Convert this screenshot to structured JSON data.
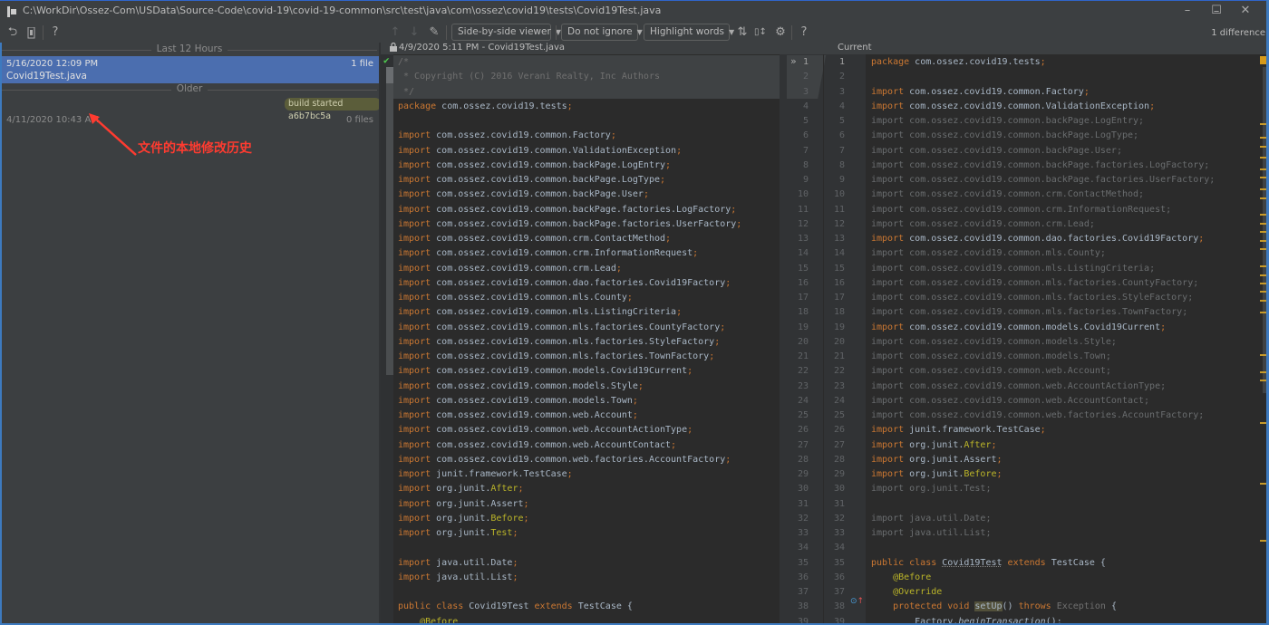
{
  "window": {
    "title": "C:\\WorkDir\\Ossez-Com\\USData\\Source-Code\\covid-19\\covid-19-common\\src\\test\\java\\com\\ossez\\covid19\\tests\\Covid19Test.java",
    "minimize": "–",
    "maximize": "☐",
    "close": "✕"
  },
  "toolbar": {
    "revert_icon": "⮌",
    "patch_icon": "▮",
    "help_icon": "?",
    "prev_diff_icon": "↑",
    "next_diff_icon": "↓",
    "edit_icon": "✎",
    "viewer_select": "Side-by-side viewer",
    "ignore_select": "Do not ignore",
    "highlight_select": "Highlight words",
    "collapse_icon": "⇅",
    "sync_scroll_icon": "▯↕",
    "settings_icon": "⚙",
    "help2_icon": "?",
    "dropdown_arrow": "▼",
    "diff_count": "1 difference"
  },
  "history": {
    "groups": [
      {
        "label": "Last 12 Hours"
      },
      {
        "label": "Older"
      }
    ],
    "revisions": [
      {
        "date": "5/16/2020 12:09 PM",
        "file": "Covid19Test.java",
        "count": "1 file",
        "selected": true
      },
      {
        "label": "build started a6b7bc5a",
        "date": "4/11/2020 10:43 AM",
        "count": "0 files",
        "selected": false
      }
    ],
    "annotation": "文件的本地修改历史"
  },
  "left_pane": {
    "header": "4/9/2020 5:11 PM - Covid19Test.java",
    "lock_icon": "🔒",
    "ok_icon": "✔",
    "lines": [
      [
        [
          "cm",
          "/*"
        ]
      ],
      [
        [
          "cm",
          " * Copyright (C) 2016 Verani Realty, Inc Authors"
        ]
      ],
      [
        [
          "cm",
          " */"
        ]
      ],
      [
        [
          "kw",
          "package "
        ],
        [
          "id",
          "com.ossez.covid19.tests"
        ],
        [
          "sc",
          ";"
        ]
      ],
      [],
      [
        [
          "kw",
          "import "
        ],
        [
          "id",
          "com.ossez.covid19.common.Factory"
        ],
        [
          "sc",
          ";"
        ]
      ],
      [
        [
          "kw",
          "import "
        ],
        [
          "id",
          "com.ossez.covid19.common.ValidationException"
        ],
        [
          "sc",
          ";"
        ]
      ],
      [
        [
          "kw",
          "import "
        ],
        [
          "id",
          "com.ossez.covid19.common.backPage.LogEntry"
        ],
        [
          "sc",
          ";"
        ]
      ],
      [
        [
          "kw",
          "import "
        ],
        [
          "id",
          "com.ossez.covid19.common.backPage.LogType"
        ],
        [
          "sc",
          ";"
        ]
      ],
      [
        [
          "kw",
          "import "
        ],
        [
          "id",
          "com.ossez.covid19.common.backPage.User"
        ],
        [
          "sc",
          ";"
        ]
      ],
      [
        [
          "kw",
          "import "
        ],
        [
          "id",
          "com.ossez.covid19.common.backPage.factories.LogFactory"
        ],
        [
          "sc",
          ";"
        ]
      ],
      [
        [
          "kw",
          "import "
        ],
        [
          "id",
          "com.ossez.covid19.common.backPage.factories.UserFactory"
        ],
        [
          "sc",
          ";"
        ]
      ],
      [
        [
          "kw",
          "import "
        ],
        [
          "id",
          "com.ossez.covid19.common.crm.ContactMethod"
        ],
        [
          "sc",
          ";"
        ]
      ],
      [
        [
          "kw",
          "import "
        ],
        [
          "id",
          "com.ossez.covid19.common.crm.InformationRequest"
        ],
        [
          "sc",
          ";"
        ]
      ],
      [
        [
          "kw",
          "import "
        ],
        [
          "id",
          "com.ossez.covid19.common.crm.Lead"
        ],
        [
          "sc",
          ";"
        ]
      ],
      [
        [
          "kw",
          "import "
        ],
        [
          "id",
          "com.ossez.covid19.common.dao.factories.Covid19Factory"
        ],
        [
          "sc",
          ";"
        ]
      ],
      [
        [
          "kw",
          "import "
        ],
        [
          "id",
          "com.ossez.covid19.common.mls.County"
        ],
        [
          "sc",
          ";"
        ]
      ],
      [
        [
          "kw",
          "import "
        ],
        [
          "id",
          "com.ossez.covid19.common.mls.ListingCriteria"
        ],
        [
          "sc",
          ";"
        ]
      ],
      [
        [
          "kw",
          "import "
        ],
        [
          "id",
          "com.ossez.covid19.common.mls.factories.CountyFactory"
        ],
        [
          "sc",
          ";"
        ]
      ],
      [
        [
          "kw",
          "import "
        ],
        [
          "id",
          "com.ossez.covid19.common.mls.factories.StyleFactory"
        ],
        [
          "sc",
          ";"
        ]
      ],
      [
        [
          "kw",
          "import "
        ],
        [
          "id",
          "com.ossez.covid19.common.mls.factories.TownFactory"
        ],
        [
          "sc",
          ";"
        ]
      ],
      [
        [
          "kw",
          "import "
        ],
        [
          "id",
          "com.ossez.covid19.common.models.Covid19Current"
        ],
        [
          "sc",
          ";"
        ]
      ],
      [
        [
          "kw",
          "import "
        ],
        [
          "id",
          "com.ossez.covid19.common.models.Style"
        ],
        [
          "sc",
          ";"
        ]
      ],
      [
        [
          "kw",
          "import "
        ],
        [
          "id",
          "com.ossez.covid19.common.models.Town"
        ],
        [
          "sc",
          ";"
        ]
      ],
      [
        [
          "kw",
          "import "
        ],
        [
          "id",
          "com.ossez.covid19.common.web.Account"
        ],
        [
          "sc",
          ";"
        ]
      ],
      [
        [
          "kw",
          "import "
        ],
        [
          "id",
          "com.ossez.covid19.common.web.AccountActionType"
        ],
        [
          "sc",
          ";"
        ]
      ],
      [
        [
          "kw",
          "import "
        ],
        [
          "id",
          "com.ossez.covid19.common.web.AccountContact"
        ],
        [
          "sc",
          ";"
        ]
      ],
      [
        [
          "kw",
          "import "
        ],
        [
          "id",
          "com.ossez.covid19.common.web.factories.AccountFactory"
        ],
        [
          "sc",
          ";"
        ]
      ],
      [
        [
          "kw",
          "import "
        ],
        [
          "id",
          "junit.framework.TestCase"
        ],
        [
          "sc",
          ";"
        ]
      ],
      [
        [
          "kw",
          "import "
        ],
        [
          "id",
          "org.junit."
        ],
        [
          "an",
          "After"
        ],
        [
          "sc",
          ";"
        ]
      ],
      [
        [
          "kw",
          "import "
        ],
        [
          "id",
          "org.junit.Assert"
        ],
        [
          "sc",
          ";"
        ]
      ],
      [
        [
          "kw",
          "import "
        ],
        [
          "id",
          "org.junit."
        ],
        [
          "an",
          "Before"
        ],
        [
          "sc",
          ";"
        ]
      ],
      [
        [
          "kw",
          "import "
        ],
        [
          "id",
          "org.junit."
        ],
        [
          "an",
          "Test"
        ],
        [
          "sc",
          ";"
        ]
      ],
      [],
      [
        [
          "kw",
          "import "
        ],
        [
          "id",
          "java.util.Date"
        ],
        [
          "sc",
          ";"
        ]
      ],
      [
        [
          "kw",
          "import "
        ],
        [
          "id",
          "java.util.List"
        ],
        [
          "sc",
          ";"
        ]
      ],
      [],
      [
        [
          "kw",
          "public class "
        ],
        [
          "id",
          "Covid19Test "
        ],
        [
          "kw",
          "extends "
        ],
        [
          "id",
          "TestCase {"
        ]
      ],
      [
        [
          "an",
          "    @Before"
        ]
      ]
    ]
  },
  "right_pane": {
    "header": "Current",
    "old_line_numbers_start": 1,
    "new_line_numbers_start": 1,
    "lines": [
      {
        "dim": false,
        "tokens": [
          [
            "kw",
            "package "
          ],
          [
            "id",
            "com.ossez.covid19.tests"
          ],
          [
            "sc",
            ";"
          ]
        ]
      },
      {
        "dim": false,
        "tokens": []
      },
      {
        "dim": false,
        "tokens": [
          [
            "kw",
            "import "
          ],
          [
            "id",
            "com.ossez.covid19.common.Factory"
          ],
          [
            "sc",
            ";"
          ]
        ]
      },
      {
        "dim": false,
        "tokens": [
          [
            "kw",
            "import "
          ],
          [
            "id",
            "com.ossez.covid19.common.ValidationException"
          ],
          [
            "sc",
            ";"
          ]
        ]
      },
      {
        "dim": true,
        "tokens": [
          [
            "kw",
            "import "
          ],
          [
            "id",
            "com.ossez.covid19.common.backPage.LogEntry"
          ],
          [
            "sc",
            ";"
          ]
        ]
      },
      {
        "dim": true,
        "tokens": [
          [
            "kw",
            "import "
          ],
          [
            "id",
            "com.ossez.covid19.common.backPage.LogType"
          ],
          [
            "sc",
            ";"
          ]
        ]
      },
      {
        "dim": true,
        "tokens": [
          [
            "kw",
            "import "
          ],
          [
            "id",
            "com.ossez.covid19.common.backPage.User"
          ],
          [
            "sc",
            ";"
          ]
        ]
      },
      {
        "dim": true,
        "tokens": [
          [
            "kw",
            "import "
          ],
          [
            "id",
            "com.ossez.covid19.common.backPage.factories.LogFactory"
          ],
          [
            "sc",
            ";"
          ]
        ]
      },
      {
        "dim": true,
        "tokens": [
          [
            "kw",
            "import "
          ],
          [
            "id",
            "com.ossez.covid19.common.backPage.factories.UserFactory"
          ],
          [
            "sc",
            ";"
          ]
        ]
      },
      {
        "dim": true,
        "tokens": [
          [
            "kw",
            "import "
          ],
          [
            "id",
            "com.ossez.covid19.common.crm.ContactMethod"
          ],
          [
            "sc",
            ";"
          ]
        ]
      },
      {
        "dim": true,
        "tokens": [
          [
            "kw",
            "import "
          ],
          [
            "id",
            "com.ossez.covid19.common.crm.InformationRequest"
          ],
          [
            "sc",
            ";"
          ]
        ]
      },
      {
        "dim": true,
        "tokens": [
          [
            "kw",
            "import "
          ],
          [
            "id",
            "com.ossez.covid19.common.crm.Lead"
          ],
          [
            "sc",
            ";"
          ]
        ]
      },
      {
        "dim": false,
        "tokens": [
          [
            "kw",
            "import "
          ],
          [
            "id",
            "com.ossez.covid19.common.dao.factories.Covid19Factory"
          ],
          [
            "sc",
            ";"
          ]
        ]
      },
      {
        "dim": true,
        "tokens": [
          [
            "kw",
            "import "
          ],
          [
            "id",
            "com.ossez.covid19.common.mls.County"
          ],
          [
            "sc",
            ";"
          ]
        ]
      },
      {
        "dim": true,
        "tokens": [
          [
            "kw",
            "import "
          ],
          [
            "id",
            "com.ossez.covid19.common.mls.ListingCriteria"
          ],
          [
            "sc",
            ";"
          ]
        ]
      },
      {
        "dim": true,
        "tokens": [
          [
            "kw",
            "import "
          ],
          [
            "id",
            "com.ossez.covid19.common.mls.factories.CountyFactory"
          ],
          [
            "sc",
            ";"
          ]
        ]
      },
      {
        "dim": true,
        "tokens": [
          [
            "kw",
            "import "
          ],
          [
            "id",
            "com.ossez.covid19.common.mls.factories.StyleFactory"
          ],
          [
            "sc",
            ";"
          ]
        ]
      },
      {
        "dim": true,
        "tokens": [
          [
            "kw",
            "import "
          ],
          [
            "id",
            "com.ossez.covid19.common.mls.factories.TownFactory"
          ],
          [
            "sc",
            ";"
          ]
        ]
      },
      {
        "dim": false,
        "tokens": [
          [
            "kw",
            "import "
          ],
          [
            "id",
            "com.ossez.covid19.common.models.Covid19Current"
          ],
          [
            "sc",
            ";"
          ]
        ]
      },
      {
        "dim": true,
        "tokens": [
          [
            "kw",
            "import "
          ],
          [
            "id",
            "com.ossez.covid19.common.models.Style"
          ],
          [
            "sc",
            ";"
          ]
        ]
      },
      {
        "dim": true,
        "tokens": [
          [
            "kw",
            "import "
          ],
          [
            "id",
            "com.ossez.covid19.common.models.Town"
          ],
          [
            "sc",
            ";"
          ]
        ]
      },
      {
        "dim": true,
        "tokens": [
          [
            "kw",
            "import "
          ],
          [
            "id",
            "com.ossez.covid19.common.web.Account"
          ],
          [
            "sc",
            ";"
          ]
        ]
      },
      {
        "dim": true,
        "tokens": [
          [
            "kw",
            "import "
          ],
          [
            "id",
            "com.ossez.covid19.common.web.AccountActionType"
          ],
          [
            "sc",
            ";"
          ]
        ]
      },
      {
        "dim": true,
        "tokens": [
          [
            "kw",
            "import "
          ],
          [
            "id",
            "com.ossez.covid19.common.web.AccountContact"
          ],
          [
            "sc",
            ";"
          ]
        ]
      },
      {
        "dim": true,
        "tokens": [
          [
            "kw",
            "import "
          ],
          [
            "id",
            "com.ossez.covid19.common.web.factories.AccountFactory"
          ],
          [
            "sc",
            ";"
          ]
        ]
      },
      {
        "dim": false,
        "tokens": [
          [
            "kw",
            "import "
          ],
          [
            "id",
            "junit.framework.TestCase"
          ],
          [
            "sc",
            ";"
          ]
        ]
      },
      {
        "dim": false,
        "tokens": [
          [
            "kw",
            "import "
          ],
          [
            "id",
            "org.junit."
          ],
          [
            "an",
            "After"
          ],
          [
            "sc",
            ";"
          ]
        ]
      },
      {
        "dim": false,
        "tokens": [
          [
            "kw",
            "import "
          ],
          [
            "id",
            "org.junit.Assert"
          ],
          [
            "sc",
            ";"
          ]
        ]
      },
      {
        "dim": false,
        "tokens": [
          [
            "kw",
            "import "
          ],
          [
            "id",
            "org.junit."
          ],
          [
            "an",
            "Before"
          ],
          [
            "sc",
            ";"
          ]
        ]
      },
      {
        "dim": true,
        "tokens": [
          [
            "kw",
            "import "
          ],
          [
            "id",
            "org.junit.Test"
          ],
          [
            "sc",
            ";"
          ]
        ]
      },
      {
        "dim": false,
        "tokens": []
      },
      {
        "dim": true,
        "tokens": [
          [
            "kw",
            "import "
          ],
          [
            "id",
            "java.util.Date"
          ],
          [
            "sc",
            ";"
          ]
        ]
      },
      {
        "dim": true,
        "tokens": [
          [
            "kw",
            "import "
          ],
          [
            "id",
            "java.util.List"
          ],
          [
            "sc",
            ";"
          ]
        ]
      },
      {
        "dim": false,
        "tokens": []
      },
      {
        "dim": false,
        "tokens": [
          [
            "kw",
            "public class "
          ],
          [
            "ul",
            "Covid19Test"
          ],
          [
            "id",
            " "
          ],
          [
            "kw",
            "extends "
          ],
          [
            "id",
            "TestCase {"
          ]
        ]
      },
      {
        "dim": false,
        "tokens": [
          [
            "an",
            "    @Before"
          ]
        ]
      },
      {
        "dim": false,
        "tokens": [
          [
            "an",
            "    @Override"
          ]
        ]
      },
      {
        "dim": false,
        "tokens": [
          [
            "kw",
            "    protected void "
          ],
          [
            "hl",
            "setUp"
          ],
          [
            "id",
            "() "
          ],
          [
            "kw",
            "throws "
          ],
          [
            "cm",
            "Exception "
          ],
          [
            "id",
            "{"
          ]
        ]
      },
      {
        "dim": false,
        "tokens": [
          [
            "id",
            "        Factory."
          ],
          [
            "it",
            "beginTransaction"
          ],
          [
            "id",
            "();"
          ]
        ]
      }
    ],
    "scroll_markers_fraction": [
      0.12,
      0.145,
      0.16,
      0.18,
      0.2,
      0.215,
      0.235,
      0.25,
      0.28,
      0.295,
      0.31,
      0.325,
      0.34,
      0.37,
      0.385,
      0.4,
      0.415,
      0.43,
      0.45,
      0.525,
      0.555,
      0.57,
      0.645,
      0.75,
      0.85
    ]
  }
}
